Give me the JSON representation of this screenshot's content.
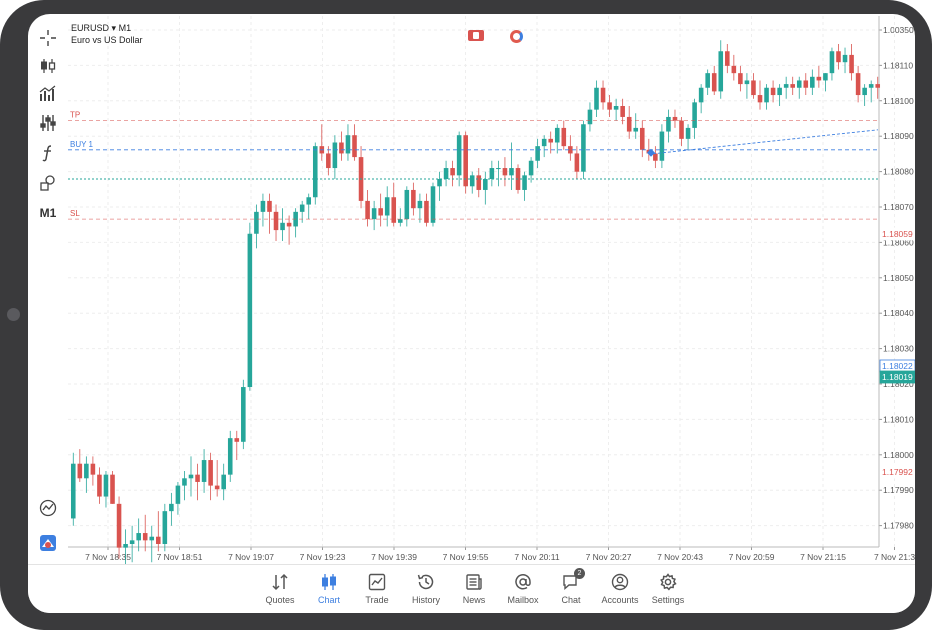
{
  "symbol": {
    "ticker": "EURUSD",
    "dropdown_glyph": "▾",
    "timeframe": "M1",
    "description": "Euro vs US Dollar"
  },
  "toolbar": {
    "timeframe_label": "M1",
    "icons": [
      "crosshair-icon",
      "candlestick-icon",
      "volume-bars-icon",
      "indicators-sliders-icon",
      "function-icon",
      "objects-icon",
      "m1-timeframe",
      "chart-settings-icon",
      "app-logo-icon"
    ]
  },
  "chart_data": {
    "type": "candlestick",
    "symbol": "EURUSD",
    "timeframe": "M1",
    "y_ticks": [
      "1.00350",
      "1.18110",
      "1.18100",
      "1.18090",
      "1.18080",
      "1.18070",
      "1.18060",
      "1.18050",
      "1.18040",
      "1.18030",
      "1.18020",
      "1.18010",
      "1.18000",
      "1.17990",
      "1.17980"
    ],
    "x_ticks": [
      "7 Nov 18:35",
      "7 Nov 18:51",
      "7 Nov 19:07",
      "7 Nov 19:23",
      "7 Nov 19:39",
      "7 Nov 19:55",
      "7 Nov 20:11",
      "7 Nov 20:27",
      "7 Nov 20:43",
      "7 Nov 20:59",
      "7 Nov 21:15",
      "7 Nov 21:3"
    ],
    "ylim": [
      1.17975,
      1.18115
    ],
    "grid": true,
    "price_labels": {
      "tp": "1.18059",
      "sl": "1.17992",
      "buy": "1.18022",
      "current": "1.18019"
    },
    "levels": [
      {
        "name": "TP",
        "price": 1.18091,
        "color": "#d9534f"
      },
      {
        "name": "BUY 1",
        "price": 1.18083,
        "color": "#3d7fe0"
      },
      {
        "name": "SL",
        "price": 1.18064,
        "color": "#d9534f"
      },
      {
        "name": "",
        "price": 1.18075,
        "color": "#26a69a"
      }
    ],
    "level_labels": {
      "tp": "TP",
      "buy": "BUY 1",
      "sl": "SL"
    },
    "colors": {
      "up": "#26a69a",
      "down": "#d9534f",
      "grid": "#eeeeee",
      "buy": "#3d7fe0"
    },
    "candles": [
      [
        1.17982,
        1.18,
        1.1798,
        1.17997
      ],
      [
        1.17997,
        1.18001,
        1.17992,
        1.17993
      ],
      [
        1.17993,
        1.17999,
        1.17989,
        1.17997
      ],
      [
        1.17997,
        1.17999,
        1.17991,
        1.17994
      ],
      [
        1.17994,
        1.17996,
        1.17986,
        1.17988
      ],
      [
        1.17988,
        1.17995,
        1.17985,
        1.17994
      ],
      [
        1.17994,
        1.17995,
        1.17986,
        1.17986
      ],
      [
        1.17986,
        1.17988,
        1.17971,
        1.17974
      ],
      [
        1.17974,
        1.17979,
        1.17969,
        1.17975
      ],
      [
        1.17975,
        1.1798,
        1.1797,
        1.17976
      ],
      [
        1.17976,
        1.17982,
        1.17973,
        1.17978
      ],
      [
        1.17978,
        1.17983,
        1.17973,
        1.17976
      ],
      [
        1.17976,
        1.1798,
        1.1797,
        1.17977
      ],
      [
        1.17977,
        1.17984,
        1.17973,
        1.17975
      ],
      [
        1.17975,
        1.17986,
        1.17973,
        1.17984
      ],
      [
        1.17984,
        1.17989,
        1.1798,
        1.17986
      ],
      [
        1.17986,
        1.17992,
        1.17983,
        1.17991
      ],
      [
        1.17991,
        1.17995,
        1.17987,
        1.17993
      ],
      [
        1.17993,
        1.17999,
        1.17988,
        1.17994
      ],
      [
        1.17994,
        1.17997,
        1.17987,
        1.17992
      ],
      [
        1.17992,
        1.18001,
        1.17989,
        1.17998
      ],
      [
        1.17998,
        1.18,
        1.17987,
        1.17991
      ],
      [
        1.17991,
        1.17998,
        1.17988,
        1.1799
      ],
      [
        1.1799,
        1.17997,
        1.17987,
        1.17994
      ],
      [
        1.17994,
        1.18006,
        1.17992,
        1.18004
      ],
      [
        1.18004,
        1.18006,
        1.17998,
        1.18003
      ],
      [
        1.18003,
        1.1802,
        1.18001,
        1.18018
      ],
      [
        1.18018,
        1.18063,
        1.18017,
        1.1806
      ],
      [
        1.1806,
        1.18068,
        1.18056,
        1.18066
      ],
      [
        1.18066,
        1.18071,
        1.18062,
        1.18069
      ],
      [
        1.18069,
        1.18071,
        1.1806,
        1.18066
      ],
      [
        1.18066,
        1.18068,
        1.18058,
        1.18061
      ],
      [
        1.18061,
        1.18067,
        1.18058,
        1.18063
      ],
      [
        1.18063,
        1.18065,
        1.18057,
        1.18062
      ],
      [
        1.18062,
        1.18067,
        1.18059,
        1.18066
      ],
      [
        1.18066,
        1.18069,
        1.18063,
        1.18068
      ],
      [
        1.18068,
        1.18071,
        1.18064,
        1.1807
      ],
      [
        1.1807,
        1.18085,
        1.18068,
        1.18084
      ],
      [
        1.18084,
        1.1809,
        1.1808,
        1.18082
      ],
      [
        1.18082,
        1.18084,
        1.18076,
        1.18078
      ],
      [
        1.18078,
        1.18087,
        1.18075,
        1.18085
      ],
      [
        1.18085,
        1.18088,
        1.1808,
        1.18082
      ],
      [
        1.18082,
        1.1809,
        1.1808,
        1.18087
      ],
      [
        1.18087,
        1.1809,
        1.1808,
        1.18081
      ],
      [
        1.18081,
        1.18084,
        1.18067,
        1.18069
      ],
      [
        1.18069,
        1.18072,
        1.18062,
        1.18064
      ],
      [
        1.18064,
        1.18069,
        1.18061,
        1.18067
      ],
      [
        1.18067,
        1.18071,
        1.18062,
        1.18065
      ],
      [
        1.18065,
        1.18073,
        1.18062,
        1.1807
      ],
      [
        1.1807,
        1.18074,
        1.18062,
        1.18063
      ],
      [
        1.18063,
        1.18067,
        1.18062,
        1.18064
      ],
      [
        1.18064,
        1.18073,
        1.18062,
        1.18072
      ],
      [
        1.18072,
        1.18074,
        1.18065,
        1.18067
      ],
      [
        1.18067,
        1.18071,
        1.18063,
        1.18069
      ],
      [
        1.18069,
        1.18071,
        1.18062,
        1.18063
      ],
      [
        1.18063,
        1.18074,
        1.18062,
        1.18073
      ],
      [
        1.18073,
        1.18077,
        1.18069,
        1.18075
      ],
      [
        1.18075,
        1.1808,
        1.18073,
        1.18078
      ],
      [
        1.18078,
        1.1808,
        1.18073,
        1.18076
      ],
      [
        1.18076,
        1.18088,
        1.18073,
        1.18087
      ],
      [
        1.18087,
        1.18088,
        1.18071,
        1.18073
      ],
      [
        1.18073,
        1.18077,
        1.18071,
        1.18076
      ],
      [
        1.18076,
        1.18078,
        1.1807,
        1.18072
      ],
      [
        1.18072,
        1.18077,
        1.18068,
        1.18075
      ],
      [
        1.18075,
        1.1808,
        1.18073,
        1.18078
      ],
      [
        1.18078,
        1.1808,
        1.18073,
        1.18078
      ],
      [
        1.18078,
        1.18081,
        1.18073,
        1.18076
      ],
      [
        1.18076,
        1.18085,
        1.18072,
        1.18078
      ],
      [
        1.18078,
        1.18079,
        1.18071,
        1.18072
      ],
      [
        1.18072,
        1.18077,
        1.18069,
        1.18076
      ],
      [
        1.18076,
        1.18081,
        1.18074,
        1.1808
      ],
      [
        1.1808,
        1.18086,
        1.18078,
        1.18084
      ],
      [
        1.18084,
        1.18087,
        1.18081,
        1.18086
      ],
      [
        1.18086,
        1.18088,
        1.18082,
        1.18085
      ],
      [
        1.18085,
        1.1809,
        1.18082,
        1.18089
      ],
      [
        1.18089,
        1.18091,
        1.18083,
        1.18084
      ],
      [
        1.18084,
        1.18087,
        1.1808,
        1.18082
      ],
      [
        1.18082,
        1.18084,
        1.18075,
        1.18077
      ],
      [
        1.18077,
        1.18091,
        1.18075,
        1.1809
      ],
      [
        1.1809,
        1.18096,
        1.18088,
        1.18094
      ],
      [
        1.18094,
        1.18102,
        1.18092,
        1.181
      ],
      [
        1.181,
        1.18102,
        1.18094,
        1.18096
      ],
      [
        1.18096,
        1.18098,
        1.18092,
        1.18094
      ],
      [
        1.18094,
        1.18097,
        1.18091,
        1.18095
      ],
      [
        1.18095,
        1.18097,
        1.1809,
        1.18092
      ],
      [
        1.18092,
        1.18095,
        1.18086,
        1.18088
      ],
      [
        1.18088,
        1.18093,
        1.18086,
        1.18089
      ],
      [
        1.18089,
        1.18091,
        1.18081,
        1.18083
      ],
      [
        1.18083,
        1.18086,
        1.1808,
        1.18082
      ],
      [
        1.18082,
        1.18084,
        1.18078,
        1.1808
      ],
      [
        1.1808,
        1.1809,
        1.18078,
        1.18088
      ],
      [
        1.18088,
        1.18094,
        1.18085,
        1.18092
      ],
      [
        1.18092,
        1.18094,
        1.18089,
        1.18091
      ],
      [
        1.18091,
        1.18092,
        1.18084,
        1.18086
      ],
      [
        1.18086,
        1.1809,
        1.18083,
        1.18089
      ],
      [
        1.18089,
        1.18097,
        1.18086,
        1.18096
      ],
      [
        1.18096,
        1.18101,
        1.18093,
        1.181
      ],
      [
        1.181,
        1.18105,
        1.18098,
        1.18104
      ],
      [
        1.18104,
        1.18106,
        1.18098,
        1.18099
      ],
      [
        1.18099,
        1.18113,
        1.18097,
        1.1811
      ],
      [
        1.1811,
        1.18112,
        1.18104,
        1.18106
      ],
      [
        1.18106,
        1.18109,
        1.18102,
        1.18104
      ],
      [
        1.18104,
        1.18106,
        1.18099,
        1.18101
      ],
      [
        1.18101,
        1.18104,
        1.18097,
        1.18102
      ],
      [
        1.18102,
        1.18104,
        1.18097,
        1.18098
      ],
      [
        1.18098,
        1.18102,
        1.18094,
        1.18096
      ],
      [
        1.18096,
        1.18101,
        1.18094,
        1.181
      ],
      [
        1.181,
        1.18102,
        1.18096,
        1.18098
      ],
      [
        1.18098,
        1.18101,
        1.18095,
        1.181
      ],
      [
        1.181,
        1.18103,
        1.18097,
        1.18101
      ],
      [
        1.18101,
        1.18103,
        1.18098,
        1.181
      ],
      [
        1.181,
        1.18103,
        1.18097,
        1.18102
      ],
      [
        1.18102,
        1.18104,
        1.18098,
        1.181
      ],
      [
        1.181,
        1.18105,
        1.18098,
        1.18103
      ],
      [
        1.18103,
        1.18106,
        1.181,
        1.18102
      ],
      [
        1.18102,
        1.18104,
        1.18099,
        1.18104
      ],
      [
        1.18104,
        1.18111,
        1.18102,
        1.1811
      ],
      [
        1.1811,
        1.18112,
        1.18105,
        1.18107
      ],
      [
        1.18107,
        1.18111,
        1.18104,
        1.18109
      ],
      [
        1.18109,
        1.18112,
        1.18102,
        1.18104
      ],
      [
        1.18104,
        1.18106,
        1.18096,
        1.18098
      ],
      [
        1.18098,
        1.18101,
        1.18095,
        1.181
      ],
      [
        1.181,
        1.18102,
        1.18096,
        1.18101
      ],
      [
        1.18101,
        1.18103,
        1.18097,
        1.181
      ]
    ]
  },
  "tabs": [
    {
      "label": "Quotes",
      "icon": "quotes-icon",
      "active": false
    },
    {
      "label": "Chart",
      "icon": "chart-icon",
      "active": true
    },
    {
      "label": "Trade",
      "icon": "trade-icon",
      "active": false
    },
    {
      "label": "History",
      "icon": "history-icon",
      "active": false
    },
    {
      "label": "News",
      "icon": "news-icon",
      "active": false
    },
    {
      "label": "Mailbox",
      "icon": "mailbox-icon",
      "active": false
    },
    {
      "label": "Chat",
      "icon": "chat-icon",
      "active": false,
      "badge": "2"
    },
    {
      "label": "Accounts",
      "icon": "accounts-icon",
      "active": false
    },
    {
      "label": "Settings",
      "icon": "settings-icon",
      "active": false
    }
  ]
}
